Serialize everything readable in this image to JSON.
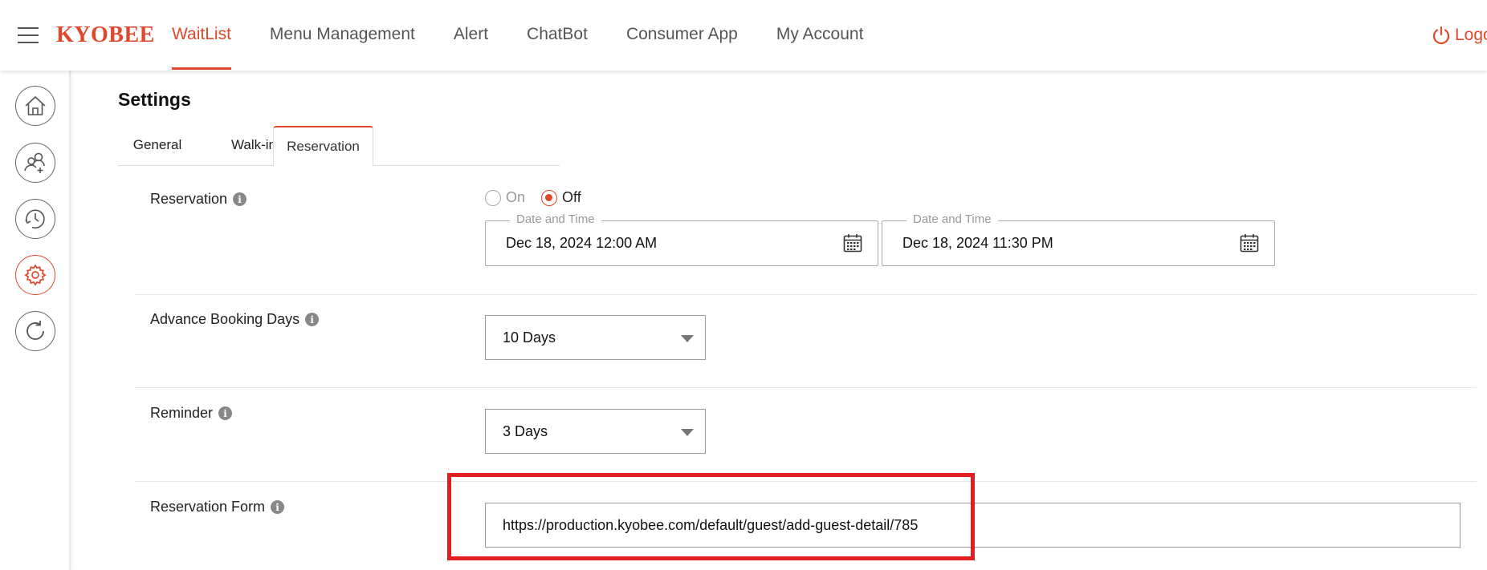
{
  "header": {
    "brand": "KYOBEE",
    "nav": [
      "WaitList",
      "Menu Management",
      "Alert",
      "ChatBot",
      "Consumer App",
      "My Account"
    ],
    "active_nav": "WaitList",
    "logout_label": "Logo"
  },
  "sidebar": {
    "items": [
      "home-icon",
      "add-user-icon",
      "history-icon",
      "gear-icon",
      "refresh-icon"
    ],
    "active": "gear-icon"
  },
  "settings": {
    "title": "Settings",
    "tabs": [
      "General",
      "Walk-in",
      "Reservation"
    ],
    "active_tab": "Reservation"
  },
  "reservation": {
    "label": "Reservation",
    "on_label": "On",
    "off_label": "Off",
    "selected": "Off",
    "start": {
      "legend": "Date and Time",
      "value": "Dec 18, 2024 12:00 AM"
    },
    "end": {
      "legend": "Date and Time",
      "value": "Dec 18, 2024 11:30 PM"
    }
  },
  "advance_booking": {
    "label": "Advance Booking Days",
    "value": "10 Days"
  },
  "reminder": {
    "label": "Reminder",
    "value": "3 Days"
  },
  "reservation_form": {
    "label": "Reservation Form",
    "url": "https://production.kyobee.com/default/guest/add-guest-detail/785"
  },
  "colors": {
    "accent": "#e0472b",
    "highlight": "#e02020"
  }
}
